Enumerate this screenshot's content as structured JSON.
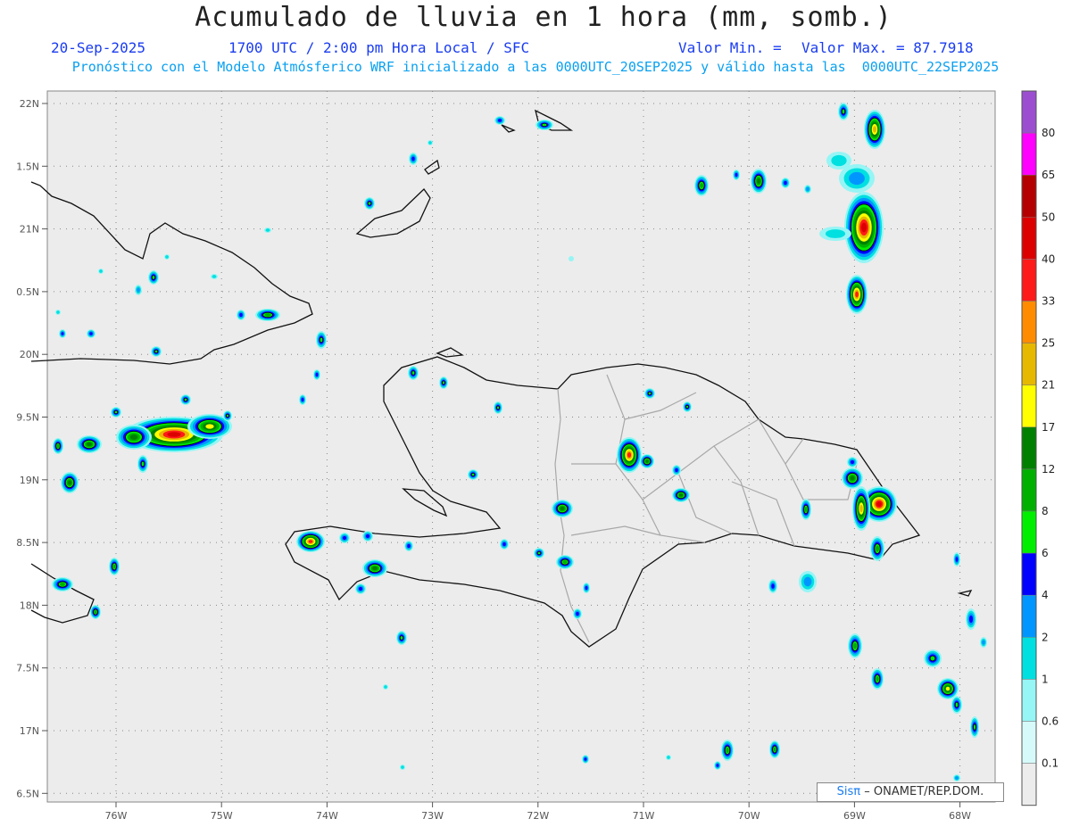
{
  "header": {
    "title": "Acumulado de lluvia en 1 hora (mm, somb.)",
    "date": "20-Sep-2025",
    "time": "1700 UTC / 2:00 pm Hora Local / SFC",
    "valor_min": "Valor Min. =",
    "valor_max": "Valor Max. = 87.7918",
    "forecast": "Pronóstico con el Modelo Atmósferico WRF inicializado a las 0000UTC_20SEP2025 y válido hasta las  0000UTC_22SEP2025"
  },
  "map": {
    "lat_labels": [
      "22N",
      "1.5N",
      "21N",
      "0.5N",
      "20N",
      "9.5N",
      "19N",
      "8.5N",
      "18N",
      "7.5N",
      "17N",
      "6.5N"
    ],
    "lon_labels": [
      "76W",
      "75W",
      "74W",
      "73W",
      "72W",
      "71W",
      "70W",
      "69W",
      "68W"
    ],
    "background": "#ececec"
  },
  "colorbar": {
    "levels": [
      "80",
      "65",
      "50",
      "40",
      "33",
      "25",
      "21",
      "17",
      "12",
      "8",
      "6",
      "4",
      "2",
      "1",
      "0.6",
      "0.1"
    ],
    "colors": [
      "#9b4fd0",
      "#ff00ff",
      "#b40000",
      "#dc0000",
      "#ff1a1a",
      "#ff8c00",
      "#e6b800",
      "#ffff00",
      "#008000",
      "#00b000",
      "#00ee00",
      "#0000ff",
      "#0096ff",
      "#00e0e0",
      "#96f5f5",
      "#d6fafa",
      "#ececec"
    ]
  },
  "credit": {
    "sis": "Sisπ",
    "org": "– ONAMET/REP.DOM."
  }
}
